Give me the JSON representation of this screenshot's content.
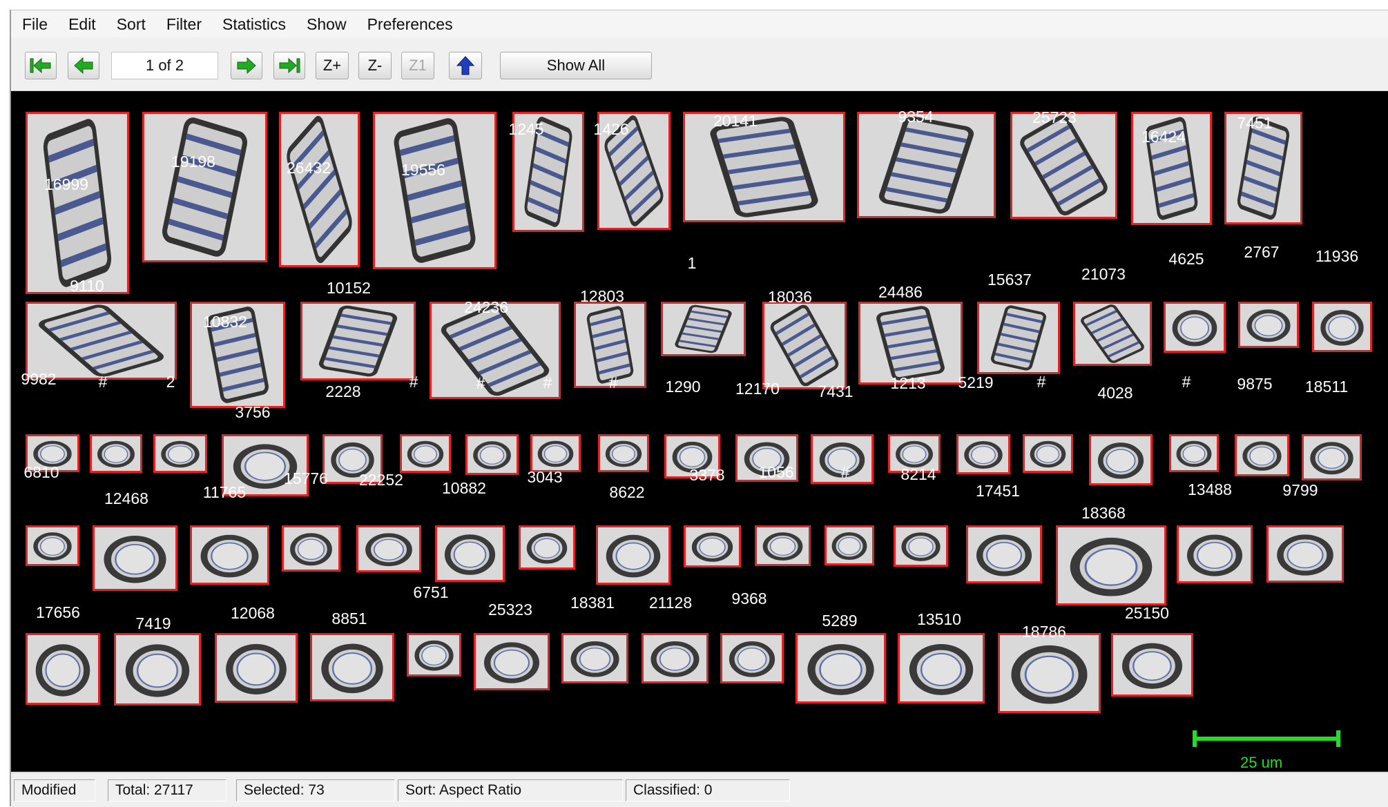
{
  "menu": [
    "File",
    "Edit",
    "Sort",
    "Filter",
    "Statistics",
    "Show",
    "Preferences"
  ],
  "toolbar": {
    "first_icon": "first-page-arrow",
    "prev_icon": "previous-page-arrow",
    "page_indicator": "1 of 2",
    "next_icon": "next-page-arrow",
    "last_icon": "last-page-arrow",
    "zoom_in": "Z+",
    "zoom_out": "Z-",
    "zoom_one": "Z1",
    "up_icon": "up-arrow",
    "show_all": "Show All"
  },
  "colors": {
    "frame": "#e02424",
    "scale": "#22dd22",
    "arrow_green": "#22aa22",
    "arrow_blue": "#1f3fbf"
  },
  "particles": [
    {
      "label": "16999",
      "shape": "chain"
    },
    {
      "label": "19198",
      "shape": "chain"
    },
    {
      "label": "26432",
      "shape": "chain"
    },
    {
      "label": "19556",
      "shape": "chain"
    },
    {
      "label": "1245",
      "shape": "chain"
    },
    {
      "label": "1426",
      "shape": "chain"
    },
    {
      "label": "20141",
      "shape": "chain"
    },
    {
      "label": "9354",
      "shape": "chain"
    },
    {
      "label": "25723",
      "shape": "chain"
    },
    {
      "label": "16424",
      "shape": "chain"
    },
    {
      "label": "7451",
      "shape": "chain"
    },
    {
      "label": "9110",
      "shape": "chain"
    },
    {
      "label": "10832",
      "shape": "chain"
    },
    {
      "label": "10152",
      "shape": "chain"
    },
    {
      "label": "24236",
      "shape": "chain"
    },
    {
      "label": "12803",
      "shape": "chain"
    },
    {
      "label": "1",
      "shape": "chain"
    },
    {
      "label": "18036",
      "shape": "chain"
    },
    {
      "label": "24486",
      "shape": "chain"
    },
    {
      "label": "15637",
      "shape": "chain"
    },
    {
      "label": "21073",
      "shape": "chain"
    },
    {
      "label": "4625",
      "shape": "cell"
    },
    {
      "label": "2767",
      "shape": "cell"
    },
    {
      "label": "11936",
      "shape": "cell"
    },
    {
      "label": "9982",
      "shape": "cell"
    },
    {
      "label": "#",
      "shape": "cell"
    },
    {
      "label": "2",
      "shape": "cell"
    },
    {
      "label": "3756",
      "shape": "cell"
    },
    {
      "label": "2228",
      "shape": "cell"
    },
    {
      "label": "#",
      "shape": "cell"
    },
    {
      "label": "#",
      "shape": "cell"
    },
    {
      "label": "#",
      "shape": "cell"
    },
    {
      "label": "#",
      "shape": "cell"
    },
    {
      "label": "1290",
      "shape": "cell"
    },
    {
      "label": "12170",
      "shape": "cell"
    },
    {
      "label": "7431",
      "shape": "cell"
    },
    {
      "label": "1213",
      "shape": "cell"
    },
    {
      "label": "5219",
      "shape": "cell"
    },
    {
      "label": "#",
      "shape": "cell"
    },
    {
      "label": "4028",
      "shape": "cell"
    },
    {
      "label": "#",
      "shape": "cell"
    },
    {
      "label": "9875",
      "shape": "cell"
    },
    {
      "label": "18511",
      "shape": "cell"
    },
    {
      "label": "6810",
      "shape": "cell"
    },
    {
      "label": "12468",
      "shape": "cell"
    },
    {
      "label": "11765",
      "shape": "cell"
    },
    {
      "label": "15776",
      "shape": "cell"
    },
    {
      "label": "22252",
      "shape": "cell"
    },
    {
      "label": "10882",
      "shape": "cell"
    },
    {
      "label": "3043",
      "shape": "cell"
    },
    {
      "label": "8622",
      "shape": "cell"
    },
    {
      "label": "3378",
      "shape": "cell"
    },
    {
      "label": "1056",
      "shape": "cell"
    },
    {
      "label": "#",
      "shape": "cell"
    },
    {
      "label": "8214",
      "shape": "cell"
    },
    {
      "label": "17451",
      "shape": "cell"
    },
    {
      "label": "18368",
      "shape": "cell"
    },
    {
      "label": "13488",
      "shape": "cell"
    },
    {
      "label": "9799",
      "shape": "cell"
    },
    {
      "label": "17656",
      "shape": "cell"
    },
    {
      "label": "7419",
      "shape": "cell"
    },
    {
      "label": "12068",
      "shape": "cell"
    },
    {
      "label": "8851",
      "shape": "cell"
    },
    {
      "label": "6751",
      "shape": "cell"
    },
    {
      "label": "25323",
      "shape": "cell"
    },
    {
      "label": "18381",
      "shape": "cell"
    },
    {
      "label": "21128",
      "shape": "cell"
    },
    {
      "label": "9368",
      "shape": "cell"
    },
    {
      "label": "5289",
      "shape": "cell"
    },
    {
      "label": "13510",
      "shape": "cell"
    },
    {
      "label": "18786",
      "shape": "cell"
    },
    {
      "label": "25150",
      "shape": "cell"
    }
  ],
  "scale_bar": {
    "label": "25 um"
  },
  "status": {
    "modified": "Modified",
    "total": "Total:  27117",
    "selected": "Selected:  73",
    "sort": "Sort: Aspect Ratio",
    "classified": "Classified:  0"
  }
}
